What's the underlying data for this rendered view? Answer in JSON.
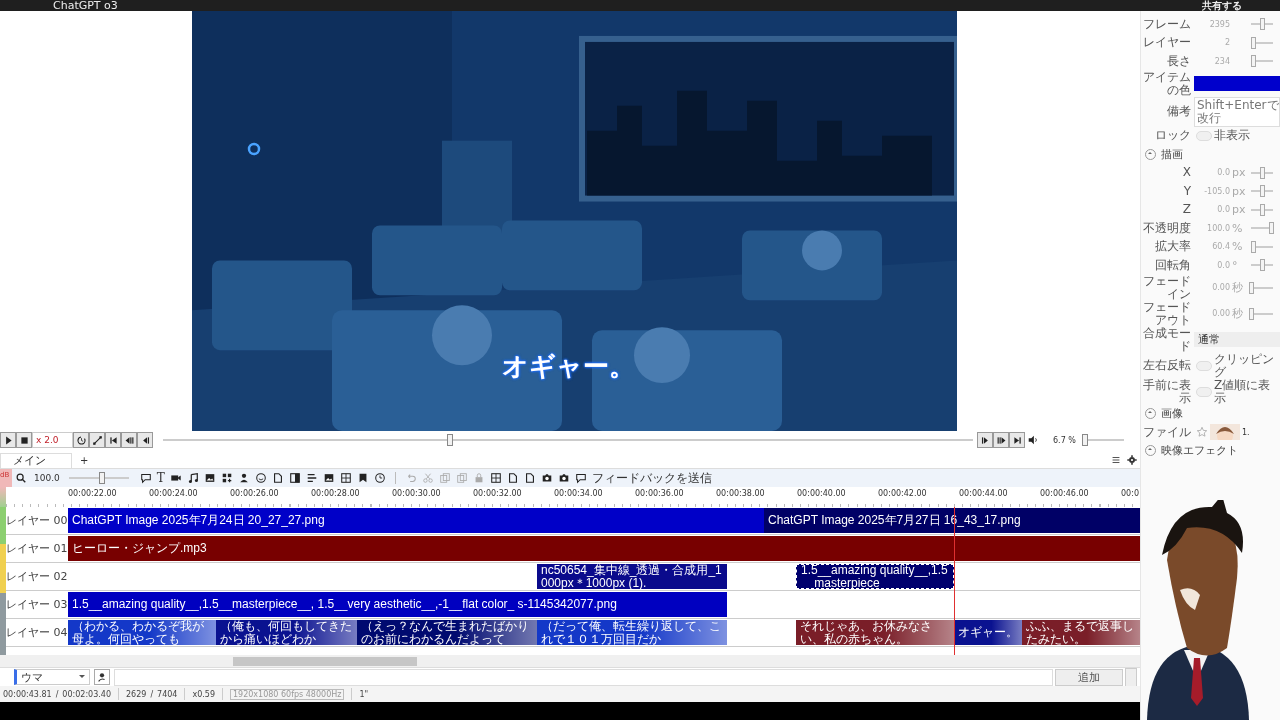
{
  "top_bar": {
    "app_title": "ChatGPT o3",
    "share_button": "共有する"
  },
  "preview": {
    "kind": "picture",
    "subtitle": "オギャー。"
  },
  "properties": [
    {
      "kind": "number",
      "label": "フレーム",
      "value": "2395",
      "level": 0.5
    },
    {
      "kind": "number",
      "label": "レイヤー",
      "value": "2",
      "level": 0.1
    },
    {
      "kind": "number",
      "label": "長さ",
      "value": "234",
      "level": 0.1
    },
    {
      "kind": "color",
      "label": "アイテムの色",
      "color": "#0000cc"
    },
    {
      "kind": "text",
      "label": "備考",
      "placeholder": "Shift+Enterで改行"
    },
    {
      "kind": "toggle",
      "label": "ロック",
      "on": false,
      "second_label": "非表示"
    },
    {
      "kind": "section",
      "label": "描画",
      "expanded": true
    },
    {
      "kind": "number",
      "label": "X",
      "value": "0.0",
      "unit": "px",
      "level": 0.5
    },
    {
      "kind": "number",
      "label": "Y",
      "value": "-105.0",
      "unit": "px",
      "level": 0.5
    },
    {
      "kind": "number",
      "label": "Z",
      "value": "0.0",
      "unit": "px",
      "level": 0.5
    },
    {
      "kind": "number",
      "label": "不透明度",
      "value": "100.0",
      "unit": "%",
      "level": 0.9
    },
    {
      "kind": "number",
      "label": "拡大率",
      "value": "60.4",
      "unit": "%",
      "level": 0.1
    },
    {
      "kind": "number",
      "label": "回転角",
      "value": "0.0",
      "unit": "°",
      "level": 0.5
    },
    {
      "kind": "number",
      "label": "フェードイン",
      "value": "0.00",
      "unit": "秒",
      "level": 0.0
    },
    {
      "kind": "number",
      "label": "フェードアウト",
      "value": "0.00",
      "unit": "秒",
      "level": 0.0
    },
    {
      "kind": "select",
      "label": "合成モード",
      "value": "通常"
    },
    {
      "kind": "toggle",
      "label": "左右反転",
      "on": false,
      "second_label": "クリッピング"
    },
    {
      "kind": "toggle",
      "label": "手前に表示",
      "on": false,
      "second_label": "Z値順に表示"
    },
    {
      "kind": "section",
      "label": "画像",
      "expanded": true
    },
    {
      "kind": "file",
      "label": "ファイル",
      "value": "1."
    },
    {
      "kind": "section",
      "label": "映像エフェクト",
      "expanded": true
    }
  ],
  "transport": {
    "speed": "x 2.0",
    "seek": {
      "level": 0.354
    },
    "zoom": "6.7 %",
    "volume": {
      "level": 0.03
    }
  },
  "tabs": [
    {
      "label": "メイン",
      "selected": true
    }
  ],
  "add_tab": "+",
  "toolbar": {
    "meter_label": "dB",
    "zoom_value": "100.0",
    "zoom_slider": {
      "level": 0.55
    },
    "text_tool": "T",
    "feedback_button": "フィードバックを送信"
  },
  "timeline": {
    "ruler": [
      "00:00:22.00",
      "00:00:24.00",
      "00:00:26.00",
      "00:00:28.00",
      "00:00:30.00",
      "00:00:32.00",
      "00:00:34.00",
      "00:00:36.00",
      "00:00:38.00",
      "00:00:40.00",
      "00:00:42.00",
      "00:00:44.00",
      "00:00:46.00",
      "00:0"
    ],
    "layers": [
      {
        "label": "レイヤー 00",
        "clips": [
          {
            "kind": "media",
            "text": "ChatGPT Image 2025年7月24日 20_27_27.png",
            "color": "#0000c8",
            "selected": false
          },
          {
            "kind": "media",
            "text": "ChatGPT Image 2025年7月27日 16_43_17.png",
            "color": "#000066",
            "selected": false
          }
        ]
      },
      {
        "label": "レイヤー 01",
        "clips": [
          {
            "kind": "media",
            "text": "ヒーロー・ジャンプ.mp3",
            "color": "#780000",
            "selected": false
          }
        ]
      },
      {
        "label": "レイヤー 02",
        "clips": [
          {
            "kind": "media",
            "text": "nc50654_集中線_透過・合成用_1000px＊1000px (1).",
            "color": "#0a0a8c",
            "selected": false
          },
          {
            "kind": "media",
            "text": "1.5__amazing quality__,1.5__masterpiece__",
            "color": "#00006e",
            "selected": true
          }
        ]
      },
      {
        "label": "レイヤー 03",
        "clips": [
          {
            "kind": "media",
            "text": "1.5__amazing quality__,1.5__masterpiece__, 1.5__very aesthetic__,-1__flat color_ s-1145342077.png",
            "color": "#0000c0",
            "selected": false
          }
        ]
      },
      {
        "label": "レイヤー 04",
        "clips": [
          {
            "kind": "voice",
            "text": "（わかる、わかるぞ我が母よ。何回やっても",
            "color": "#1438c8",
            "selected": false
          },
          {
            "kind": "voice",
            "text": "（俺も、何回もしてきたから痛いほどわか",
            "color": "#0a1290",
            "selected": false
          },
          {
            "kind": "voice",
            "text": "（えっ？なんで生まれたばかりのお前にわかるんだよって",
            "color": "#000a70",
            "selected": false
          },
          {
            "kind": "voice",
            "text": "（だって俺、転生繰り返して、これで１０１万回目だか",
            "color": "#1438c8",
            "selected": false
          },
          {
            "kind": "voice",
            "text": "それじゃあ、お休みなさい、私の赤ちゃん。",
            "color": "#7a1e28",
            "selected": false
          },
          {
            "kind": "voice",
            "text": "オギャー。",
            "color": "#0a1290",
            "selected": false
          },
          {
            "kind": "voice",
            "text": "ふふ、まるで返事したみたい。",
            "color": "#7a1e28",
            "selected": false
          }
        ]
      }
    ]
  },
  "character_select": "ウマ",
  "add_button": "追加",
  "status": {
    "current_time": "00:00:43.81",
    "time_sep": "/",
    "total_time": "00:02:03.40",
    "frame": "2629",
    "frame_sep": "/",
    "total_frames": "7404",
    "speed": "x0.59",
    "format": "1920x1080 60fps 48000Hz",
    "extra": "1\""
  }
}
